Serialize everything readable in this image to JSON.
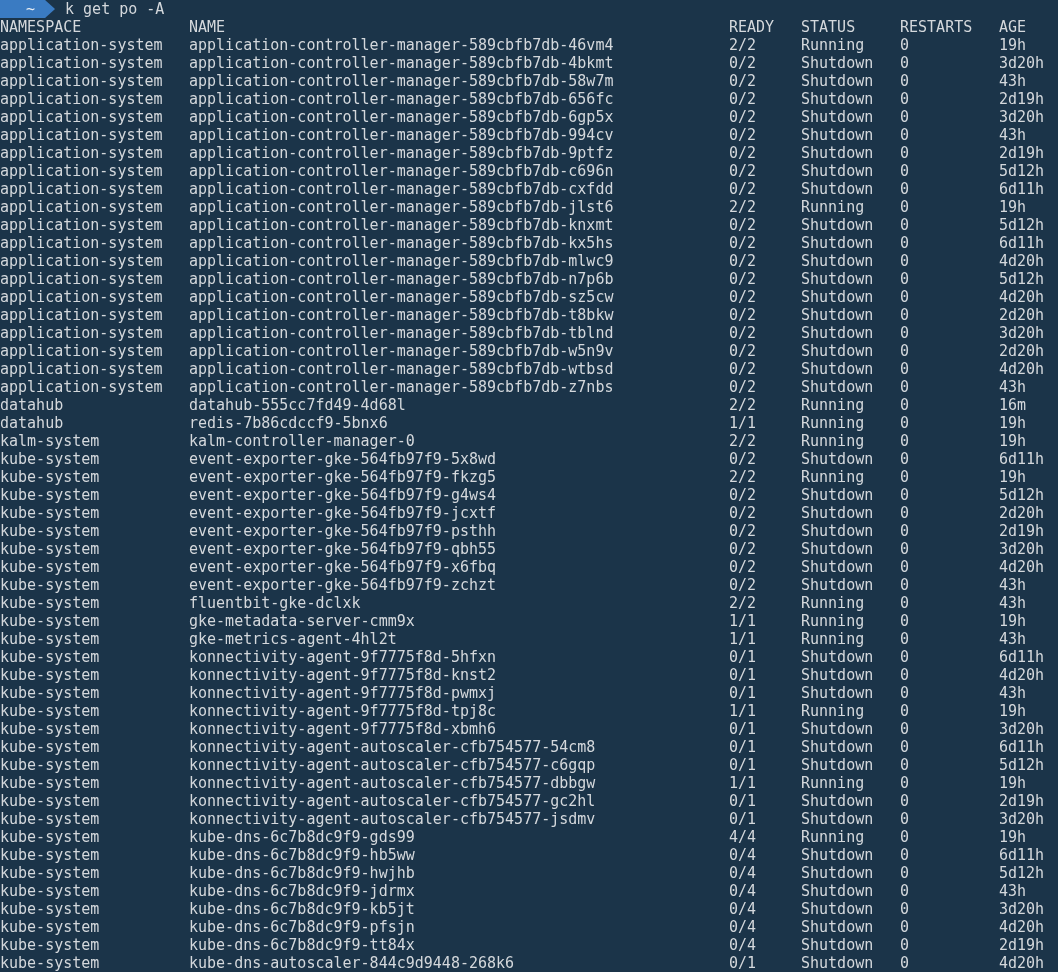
{
  "prompt": {
    "path": "~",
    "command": "k get po -A"
  },
  "table": {
    "columns": [
      "NAMESPACE",
      "NAME",
      "READY",
      "STATUS",
      "RESTARTS",
      "AGE"
    ],
    "rows": [
      [
        "application-system",
        "application-controller-manager-589cbfb7db-46vm4",
        "2/2",
        "Running",
        "0",
        "19h"
      ],
      [
        "application-system",
        "application-controller-manager-589cbfb7db-4bkmt",
        "0/2",
        "Shutdown",
        "0",
        "3d20h"
      ],
      [
        "application-system",
        "application-controller-manager-589cbfb7db-58w7m",
        "0/2",
        "Shutdown",
        "0",
        "43h"
      ],
      [
        "application-system",
        "application-controller-manager-589cbfb7db-656fc",
        "0/2",
        "Shutdown",
        "0",
        "2d19h"
      ],
      [
        "application-system",
        "application-controller-manager-589cbfb7db-6gp5x",
        "0/2",
        "Shutdown",
        "0",
        "3d20h"
      ],
      [
        "application-system",
        "application-controller-manager-589cbfb7db-994cv",
        "0/2",
        "Shutdown",
        "0",
        "43h"
      ],
      [
        "application-system",
        "application-controller-manager-589cbfb7db-9ptfz",
        "0/2",
        "Shutdown",
        "0",
        "2d19h"
      ],
      [
        "application-system",
        "application-controller-manager-589cbfb7db-c696n",
        "0/2",
        "Shutdown",
        "0",
        "5d12h"
      ],
      [
        "application-system",
        "application-controller-manager-589cbfb7db-cxfdd",
        "0/2",
        "Shutdown",
        "0",
        "6d11h"
      ],
      [
        "application-system",
        "application-controller-manager-589cbfb7db-jlst6",
        "2/2",
        "Running",
        "0",
        "19h"
      ],
      [
        "application-system",
        "application-controller-manager-589cbfb7db-knxmt",
        "0/2",
        "Shutdown",
        "0",
        "5d12h"
      ],
      [
        "application-system",
        "application-controller-manager-589cbfb7db-kx5hs",
        "0/2",
        "Shutdown",
        "0",
        "6d11h"
      ],
      [
        "application-system",
        "application-controller-manager-589cbfb7db-mlwc9",
        "0/2",
        "Shutdown",
        "0",
        "4d20h"
      ],
      [
        "application-system",
        "application-controller-manager-589cbfb7db-n7p6b",
        "0/2",
        "Shutdown",
        "0",
        "5d12h"
      ],
      [
        "application-system",
        "application-controller-manager-589cbfb7db-sz5cw",
        "0/2",
        "Shutdown",
        "0",
        "4d20h"
      ],
      [
        "application-system",
        "application-controller-manager-589cbfb7db-t8bkw",
        "0/2",
        "Shutdown",
        "0",
        "2d20h"
      ],
      [
        "application-system",
        "application-controller-manager-589cbfb7db-tblnd",
        "0/2",
        "Shutdown",
        "0",
        "3d20h"
      ],
      [
        "application-system",
        "application-controller-manager-589cbfb7db-w5n9v",
        "0/2",
        "Shutdown",
        "0",
        "2d20h"
      ],
      [
        "application-system",
        "application-controller-manager-589cbfb7db-wtbsd",
        "0/2",
        "Shutdown",
        "0",
        "4d20h"
      ],
      [
        "application-system",
        "application-controller-manager-589cbfb7db-z7nbs",
        "0/2",
        "Shutdown",
        "0",
        "43h"
      ],
      [
        "datahub",
        "datahub-555cc7fd49-4d68l",
        "2/2",
        "Running",
        "0",
        "16m"
      ],
      [
        "datahub",
        "redis-7b86cdccf9-5bnx6",
        "1/1",
        "Running",
        "0",
        "19h"
      ],
      [
        "kalm-system",
        "kalm-controller-manager-0",
        "2/2",
        "Running",
        "0",
        "19h"
      ],
      [
        "kube-system",
        "event-exporter-gke-564fb97f9-5x8wd",
        "0/2",
        "Shutdown",
        "0",
        "6d11h"
      ],
      [
        "kube-system",
        "event-exporter-gke-564fb97f9-fkzg5",
        "2/2",
        "Running",
        "0",
        "19h"
      ],
      [
        "kube-system",
        "event-exporter-gke-564fb97f9-g4ws4",
        "0/2",
        "Shutdown",
        "0",
        "5d12h"
      ],
      [
        "kube-system",
        "event-exporter-gke-564fb97f9-jcxtf",
        "0/2",
        "Shutdown",
        "0",
        "2d20h"
      ],
      [
        "kube-system",
        "event-exporter-gke-564fb97f9-psthh",
        "0/2",
        "Shutdown",
        "0",
        "2d19h"
      ],
      [
        "kube-system",
        "event-exporter-gke-564fb97f9-qbh55",
        "0/2",
        "Shutdown",
        "0",
        "3d20h"
      ],
      [
        "kube-system",
        "event-exporter-gke-564fb97f9-x6fbq",
        "0/2",
        "Shutdown",
        "0",
        "4d20h"
      ],
      [
        "kube-system",
        "event-exporter-gke-564fb97f9-zchzt",
        "0/2",
        "Shutdown",
        "0",
        "43h"
      ],
      [
        "kube-system",
        "fluentbit-gke-dclxk",
        "2/2",
        "Running",
        "0",
        "43h"
      ],
      [
        "kube-system",
        "gke-metadata-server-cmm9x",
        "1/1",
        "Running",
        "0",
        "19h"
      ],
      [
        "kube-system",
        "gke-metrics-agent-4hl2t",
        "1/1",
        "Running",
        "0",
        "43h"
      ],
      [
        "kube-system",
        "konnectivity-agent-9f7775f8d-5hfxn",
        "0/1",
        "Shutdown",
        "0",
        "6d11h"
      ],
      [
        "kube-system",
        "konnectivity-agent-9f7775f8d-knst2",
        "0/1",
        "Shutdown",
        "0",
        "4d20h"
      ],
      [
        "kube-system",
        "konnectivity-agent-9f7775f8d-pwmxj",
        "0/1",
        "Shutdown",
        "0",
        "43h"
      ],
      [
        "kube-system",
        "konnectivity-agent-9f7775f8d-tpj8c",
        "1/1",
        "Running",
        "0",
        "19h"
      ],
      [
        "kube-system",
        "konnectivity-agent-9f7775f8d-xbmh6",
        "0/1",
        "Shutdown",
        "0",
        "3d20h"
      ],
      [
        "kube-system",
        "konnectivity-agent-autoscaler-cfb754577-54cm8",
        "0/1",
        "Shutdown",
        "0",
        "6d11h"
      ],
      [
        "kube-system",
        "konnectivity-agent-autoscaler-cfb754577-c6gqp",
        "0/1",
        "Shutdown",
        "0",
        "5d12h"
      ],
      [
        "kube-system",
        "konnectivity-agent-autoscaler-cfb754577-dbbgw",
        "1/1",
        "Running",
        "0",
        "19h"
      ],
      [
        "kube-system",
        "konnectivity-agent-autoscaler-cfb754577-gc2hl",
        "0/1",
        "Shutdown",
        "0",
        "2d19h"
      ],
      [
        "kube-system",
        "konnectivity-agent-autoscaler-cfb754577-jsdmv",
        "0/1",
        "Shutdown",
        "0",
        "3d20h"
      ],
      [
        "kube-system",
        "kube-dns-6c7b8dc9f9-gds99",
        "4/4",
        "Running",
        "0",
        "19h"
      ],
      [
        "kube-system",
        "kube-dns-6c7b8dc9f9-hb5ww",
        "0/4",
        "Shutdown",
        "0",
        "6d11h"
      ],
      [
        "kube-system",
        "kube-dns-6c7b8dc9f9-hwjhb",
        "0/4",
        "Shutdown",
        "0",
        "5d12h"
      ],
      [
        "kube-system",
        "kube-dns-6c7b8dc9f9-jdrmx",
        "0/4",
        "Shutdown",
        "0",
        "43h"
      ],
      [
        "kube-system",
        "kube-dns-6c7b8dc9f9-kb5jt",
        "0/4",
        "Shutdown",
        "0",
        "3d20h"
      ],
      [
        "kube-system",
        "kube-dns-6c7b8dc9f9-pfsjn",
        "0/4",
        "Shutdown",
        "0",
        "4d20h"
      ],
      [
        "kube-system",
        "kube-dns-6c7b8dc9f9-tt84x",
        "0/4",
        "Shutdown",
        "0",
        "2d19h"
      ],
      [
        "kube-system",
        "kube-dns-autoscaler-844c9d9448-268k6",
        "0/1",
        "Shutdown",
        "0",
        "4d20h"
      ]
    ]
  }
}
